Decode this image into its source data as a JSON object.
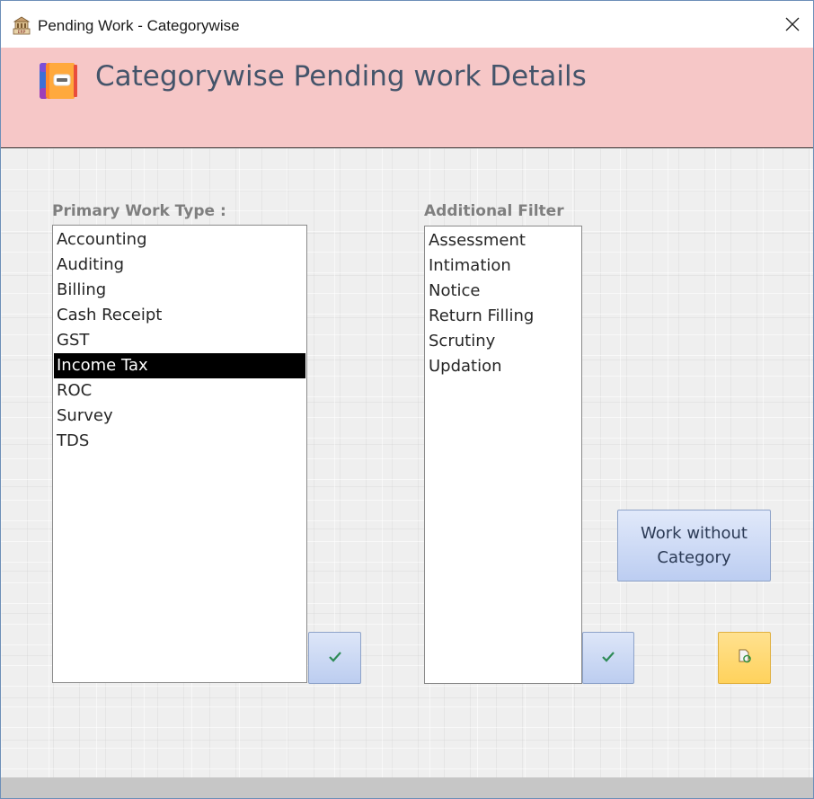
{
  "window": {
    "title": "Pending Work - Categorywise",
    "app_icon": "app-icon",
    "close_icon": "close-icon"
  },
  "header": {
    "title": "Categorywise Pending work Details",
    "icon": "notebook-icon",
    "background": "#f6c7c7"
  },
  "primary": {
    "label": "Primary Work Type :",
    "items": [
      "Accounting",
      "Auditing",
      "Billing",
      "Cash Receipt",
      "GST",
      "Income Tax",
      "ROC",
      "Survey",
      "TDS"
    ],
    "selected": "Income Tax",
    "apply_icon": "checkmark-icon"
  },
  "additional": {
    "label": "Additional Filter",
    "items": [
      "Assessment",
      "Intimation",
      "Notice",
      "Return Filling",
      "Scrutiny",
      "Updation"
    ],
    "apply_icon": "checkmark-icon"
  },
  "buttons": {
    "work_without_category": "Work without Category",
    "refresh_icon": "refresh-document-icon"
  },
  "colors": {
    "button_blue": "#c9d7f4",
    "button_yellow": "#ffd96f",
    "check_green": "#2e8b57",
    "footer": "#c6c6c6"
  }
}
